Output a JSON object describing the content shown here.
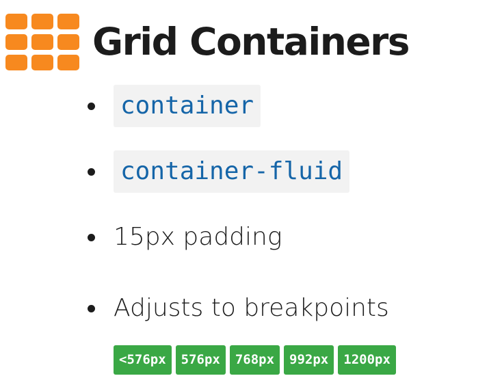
{
  "header": {
    "icon": "grid-icon",
    "icon_color": "#f7891f",
    "title": "Grid Containers"
  },
  "bullets": [
    {
      "text": "container",
      "style": "code"
    },
    {
      "text": "container-fluid",
      "style": "code"
    },
    {
      "text": "15px padding",
      "style": "plain"
    },
    {
      "text": "Adjusts to breakpoints",
      "style": "plain"
    }
  ],
  "breakpoints": [
    "<576px",
    "576px",
    "768px",
    "992px",
    "1200px"
  ],
  "colors": {
    "code_text": "#1565a8",
    "code_background": "#f2f2f2",
    "badge_background": "#3aa845",
    "badge_text": "#ffffff"
  }
}
